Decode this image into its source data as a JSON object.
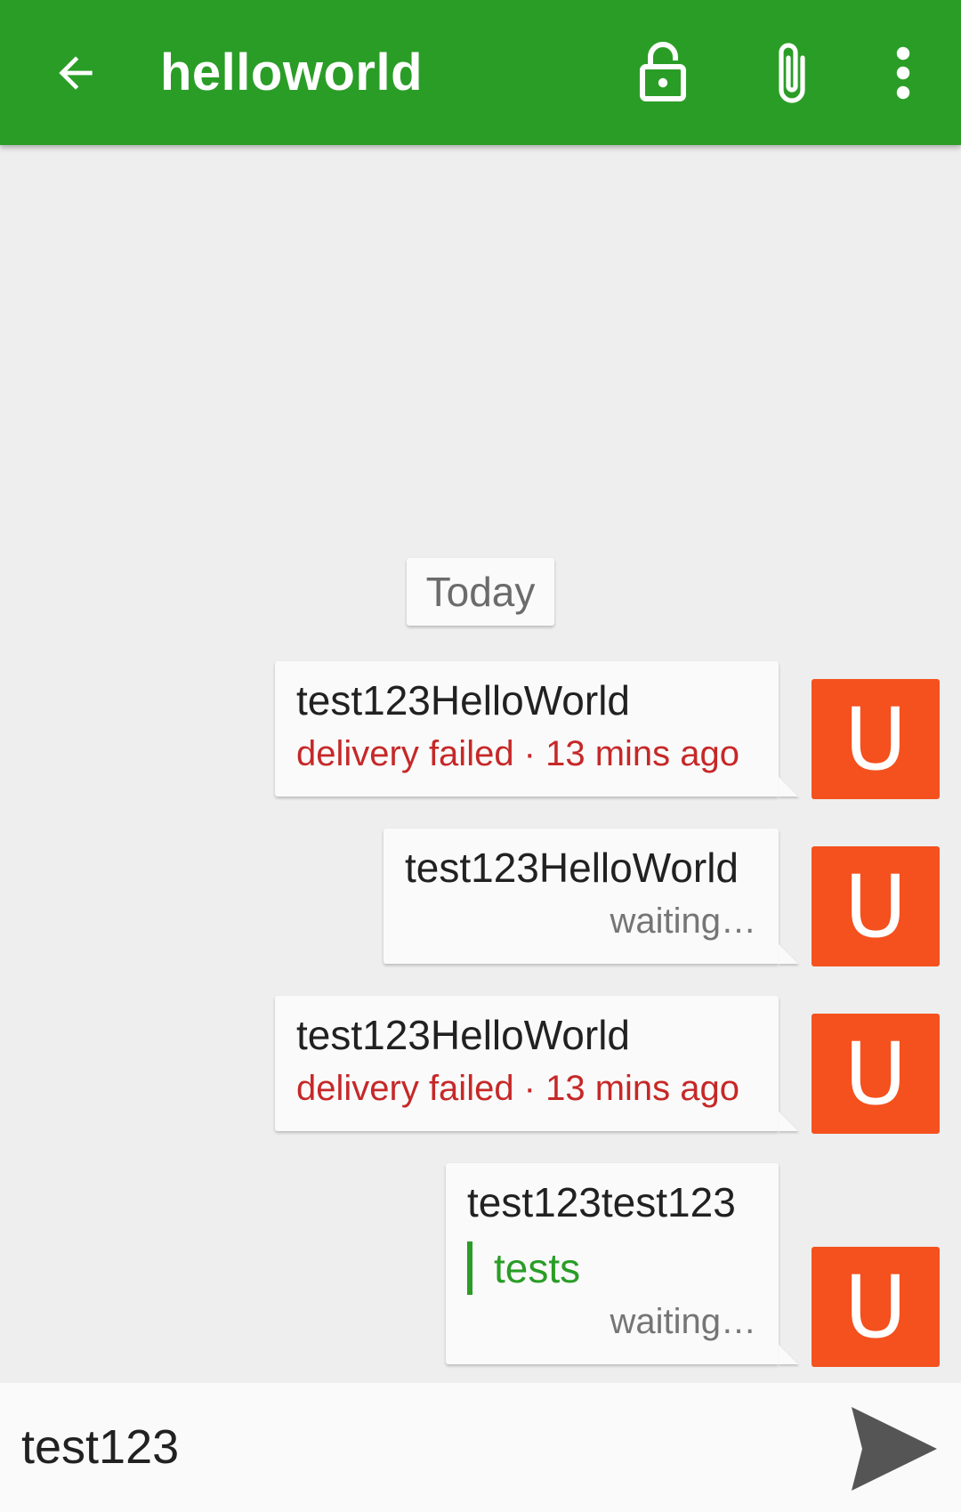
{
  "toolbar": {
    "title": "helloworld",
    "back_icon": "arrow-back-icon",
    "lock_icon": "lock-open-icon",
    "attach_icon": "paperclip-icon",
    "more_icon": "more-vert-icon",
    "color": "#2a9d27"
  },
  "conversation": {
    "date_separator": "Today",
    "messages": [
      {
        "text": "test123HelloWorld",
        "status": "delivery failed · 13 mins ago",
        "avatar_letter": "U"
      },
      {
        "text": "test123HelloWorld",
        "status": "waiting…",
        "avatar_letter": "U"
      },
      {
        "text": "test123HelloWorld",
        "status": "delivery failed · 13 mins ago",
        "avatar_letter": "U"
      },
      {
        "text": "test123test123",
        "quote": "tests",
        "status": "waiting…",
        "avatar_letter": "U"
      }
    ],
    "failed_color": "#c62828",
    "avatar_color": "#f4511e"
  },
  "composer": {
    "value": "test123",
    "send_icon": "send-icon"
  }
}
